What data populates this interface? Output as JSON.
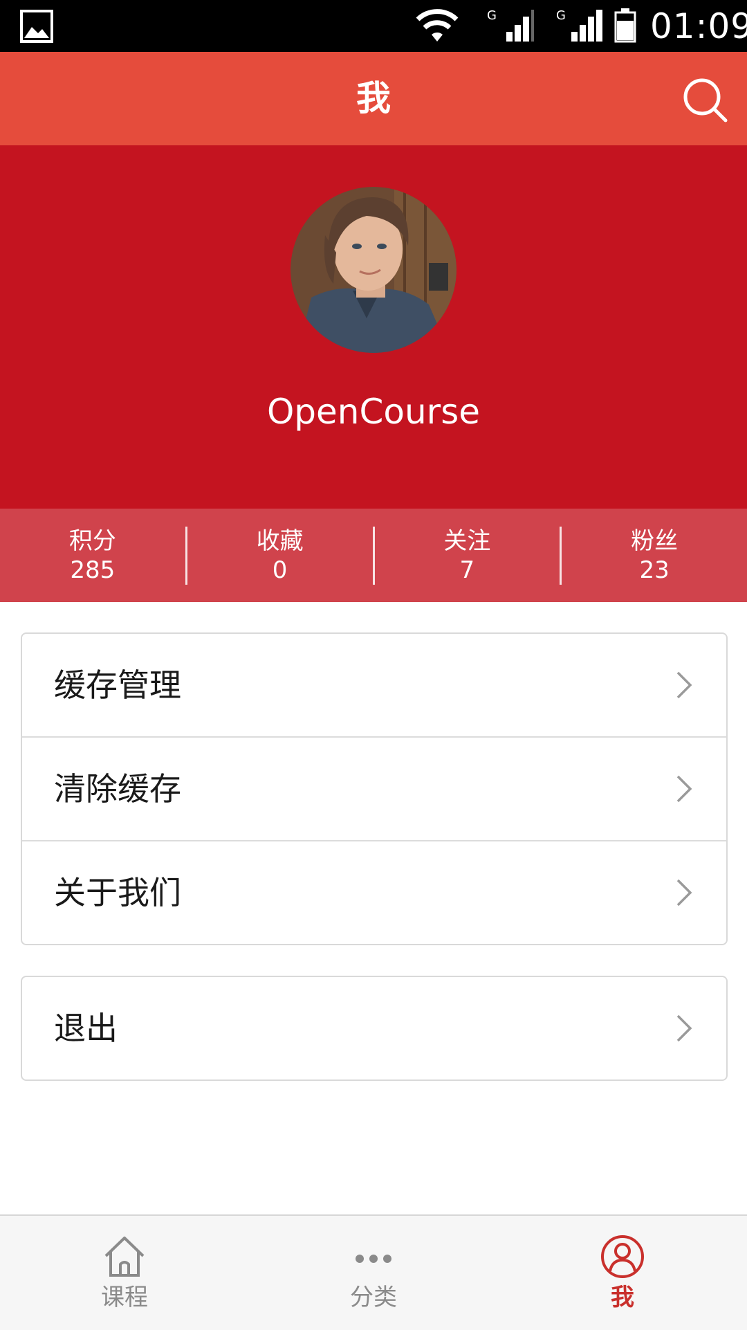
{
  "status_bar": {
    "time": "01:09",
    "icons": [
      "gallery-icon",
      "wifi-icon",
      "signal-icon",
      "signal-icon",
      "battery-icon"
    ],
    "network_labels": [
      "G",
      "G"
    ]
  },
  "header": {
    "title": "我",
    "search_icon": "search-icon"
  },
  "profile": {
    "avatar_icon": "avatar",
    "username": "OpenCourse"
  },
  "stats": [
    {
      "label": "积分",
      "value": "285"
    },
    {
      "label": "收藏",
      "value": "0"
    },
    {
      "label": "关注",
      "value": "7"
    },
    {
      "label": "粉丝",
      "value": "23"
    }
  ],
  "menu": {
    "items": [
      {
        "label": "缓存管理"
      },
      {
        "label": "清除缓存"
      },
      {
        "label": "关于我们"
      }
    ],
    "logout_label": "退出"
  },
  "bottom_nav": {
    "items": [
      {
        "label": "课程",
        "icon": "home-icon",
        "active": false
      },
      {
        "label": "分类",
        "icon": "more-dots-icon",
        "active": false
      },
      {
        "label": "我",
        "icon": "user-icon",
        "active": true
      }
    ]
  },
  "colors": {
    "title_bar": "#e54c3c",
    "profile_bg": "#c41420",
    "stats_bg": "#d0434c",
    "active_nav": "#c9302c",
    "inactive_nav": "#8a8a8a"
  }
}
